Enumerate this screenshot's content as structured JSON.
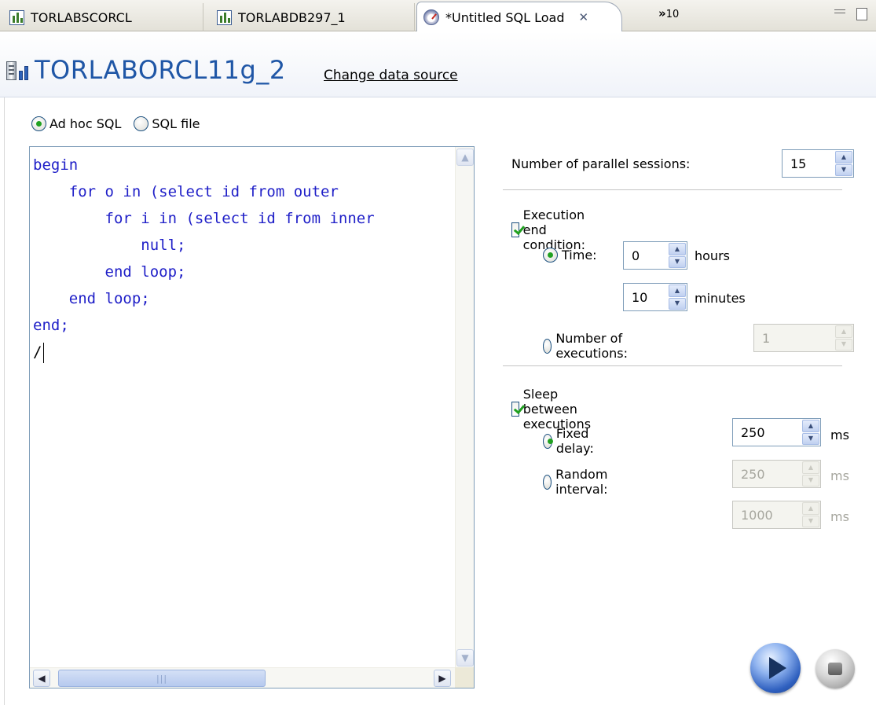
{
  "tabs": [
    {
      "label": "TORLABSCORCL",
      "icon": "chart-icon"
    },
    {
      "label": "TORLABDB297_1",
      "icon": "chart-icon"
    },
    {
      "label": "*Untitled SQL Load",
      "icon": "gauge-icon",
      "active": true
    }
  ],
  "tab_overflow": {
    "symbol": "»",
    "count": "10"
  },
  "header": {
    "title": "TORLABORCL11g_2",
    "change_link": "Change data source"
  },
  "sql_mode": {
    "adhoc_label": "Ad hoc SQL",
    "file_label": "SQL file",
    "selected": "adhoc"
  },
  "editor": {
    "lines": [
      "begin",
      "    for o in (select id from outer",
      "        for i in (select id from inner",
      "            null;",
      "        end loop;",
      "    end loop;",
      "end;",
      "/"
    ]
  },
  "settings": {
    "parallel_label": "Number of parallel sessions:",
    "parallel_value": "15",
    "end_condition": {
      "label": "Execution end condition:",
      "checked": true,
      "time_label": "Time:",
      "hours_value": "0",
      "hours_unit": "hours",
      "minutes_value": "10",
      "minutes_unit": "minutes",
      "executions_label": "Number of executions:",
      "executions_value": "1",
      "selected": "time"
    },
    "sleep": {
      "label": "Sleep between executions",
      "checked": true,
      "fixed_label": "Fixed delay:",
      "fixed_value": "250",
      "random_label": "Random interval:",
      "random_min": "250",
      "random_max": "1000",
      "unit": "ms",
      "selected": "fixed"
    }
  },
  "actions": {
    "start_icon": "play-icon",
    "stop_icon": "stop-icon"
  },
  "colors": {
    "title_blue": "#1f56a6",
    "code_blue": "#2020c8",
    "check_green": "#21a121"
  }
}
